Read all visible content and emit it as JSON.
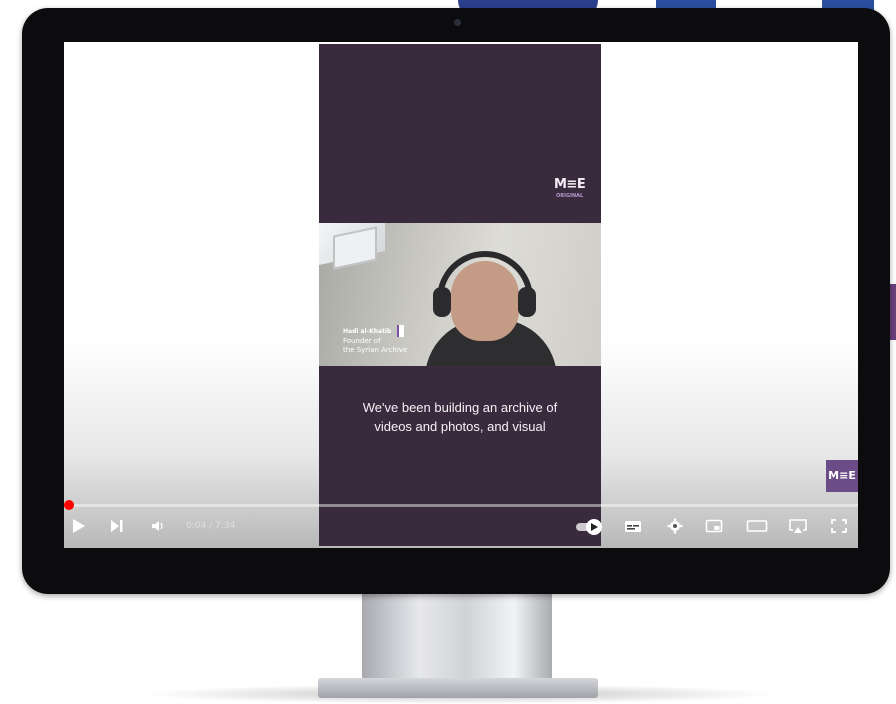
{
  "brand": {
    "logo_main": "M≡E",
    "logo_sub": "ORIGINAL"
  },
  "video": {
    "lower_third": {
      "name": "Hadi al-Khatib",
      "title_line1": "Founder of",
      "title_line2": "the Syrian Archive"
    },
    "caption_line1": "We've been building an archive of",
    "caption_line2": "videos and photos, and visual"
  },
  "player": {
    "time": "0:04 / 7:34",
    "progress_fraction": 0.005,
    "watermark": "M≡E",
    "icons": [
      "play-icon",
      "next-icon",
      "volume-icon",
      "autoplay-toggle-icon",
      "subtitles-icon",
      "settings-icon",
      "miniplayer-icon",
      "theater-mode-icon",
      "airplay-icon",
      "fullscreen-icon"
    ]
  },
  "colors": {
    "video_bg": "#3a2a3e",
    "accent_purple": "#6b4c86",
    "progress_red": "#ff0000"
  }
}
